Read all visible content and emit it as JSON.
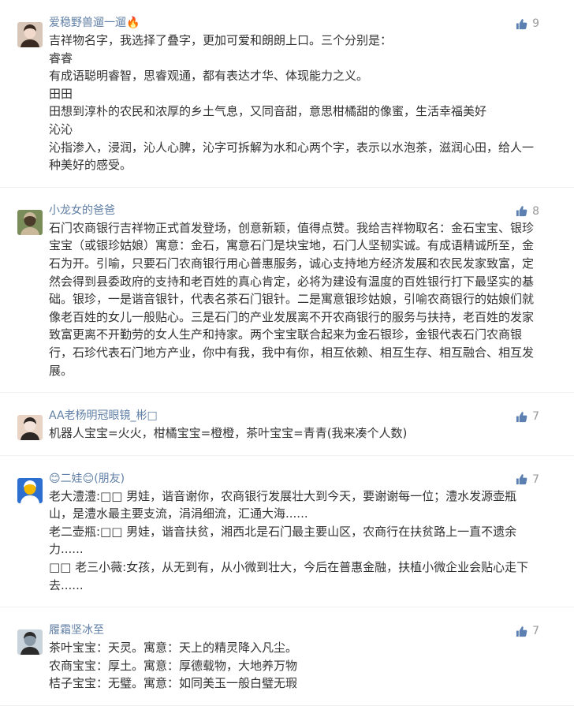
{
  "comments": [
    {
      "name": "爱稳野兽遛一遛🔥",
      "likes": "9",
      "avatar_colors": [
        "#d8c7b8",
        "#3a2b22",
        "#f1d9cc"
      ],
      "lines": [
        "吉祥物名字，我选择了叠字，更加可爱和朗朗上口。三个分别是：",
        "睿睿",
        "有成语聪明睿智，思睿观通，都有表达才华、体现能力之义。",
        "田田",
        "田想到淳朴的农民和浓厚的乡土气息，又同音甜，意思柑橘甜的像蜜，生活幸福美好",
        "沁沁",
        "沁指渗入，浸润，沁人心脾，沁字可拆解为水和心两个字，表示以水泡茶，滋润心田，给人一种美好的感受。"
      ]
    },
    {
      "name": "小龙女的爸爸",
      "likes": "8",
      "avatar_colors": [
        "#7a8c5a",
        "#c9b89a",
        "#4b3b2a"
      ],
      "lines": [
        "石门农商银行吉祥物正式首发登场，创意新颖，值得点赞。我给吉祥物取名：金石宝宝、银珍宝宝（或银珍姑娘）寓意：金石，寓意石门是块宝地，石门人坚韧实诚。有成语精诚所至，金石为开。引喻，只要石门农商银行用心普惠服务，诚心支持地方经济发展和农民发家致富，定然会得到县委政府的支持和老百姓的真心肯定，必将为建设有温度的百姓银行打下最坚实的基础。银珍，一是谐音银针，代表名茶石门银针。二是寓意银珍姑娘，引喻农商银行的姑娘们就像老百姓的女儿一般贴心。三是石门的产业发展离不开农商银行的服务与扶持，老百姓的发家致富更离不开勤劳的女人生产和持家。两个宝宝联合起来为金石银珍，金银代表石门农商银行，石珍代表石门地方产业，你中有我，我中有你，相互依赖、相互生存、相互融合、相互发展。"
      ]
    },
    {
      "name": "AA老杨明冠眼镜_彬□",
      "likes": "7",
      "avatar_colors": [
        "#e9d3c5",
        "#2c2624",
        "#f3e3da"
      ],
      "lines": [
        "机器人宝宝=火火，柑橘宝宝=橙橙，茶叶宝宝=青青(我来凑个人数)"
      ]
    },
    {
      "name": "😊二娃😊(朋友)",
      "likes": "7",
      "avatar_colors": [
        "#2d6fd0",
        "#ffffff",
        "#f2b700"
      ],
      "lines": [
        "老大澧澧:□□ 男娃，谐音谢你，农商银行发展壮大到今天，要谢谢每一位；澧水发源壶瓶山，是澧水最主要支流，涓涓细流，汇通大海......",
        "老二壶瓶:□□ 男娃，谐音扶贫，湘西北是石门最主要山区，农商行在扶贫路上一直不遗余力......",
        "□□ 老三小薇:女孩，从无到有，从小微到壮大，今后在普惠金融，扶植小微企业会贴心走下去......"
      ]
    },
    {
      "name": "履霜坚冰至",
      "likes": "7",
      "avatar_colors": [
        "#c9d3dc",
        "#2b2b2b",
        "#8a9aa8"
      ],
      "lines": [
        "茶叶宝宝：天灵。寓意：天上的精灵降入凡尘。",
        "农商宝宝：厚土。寓意：厚德载物，大地养万物",
        "桔子宝宝：无璧。寓意：如同美玉一般白璧无瑕"
      ]
    }
  ]
}
